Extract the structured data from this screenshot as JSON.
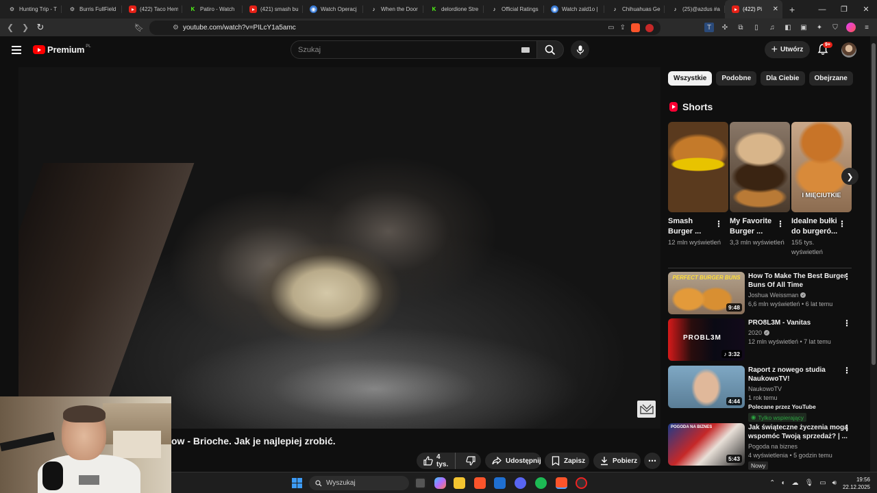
{
  "browser": {
    "tabs": [
      {
        "favicon": "gear-icon",
        "label": "Hunting Trip - T"
      },
      {
        "favicon": "gear-icon",
        "label": "Burris FullField"
      },
      {
        "favicon": "youtube-icon",
        "label": "(422) Taco Hem"
      },
      {
        "favicon": "kick-icon",
        "label": "Patiro - Watch"
      },
      {
        "favicon": "youtube-icon",
        "label": "(421) smash bu"
      },
      {
        "favicon": "eye-icon",
        "label": "Watch Operacj"
      },
      {
        "favicon": "tiktok-icon",
        "label": "When the Door"
      },
      {
        "favicon": "kick-icon",
        "label": "delordione Stre"
      },
      {
        "favicon": "tiktok-icon",
        "label": "Official Ratings"
      },
      {
        "favicon": "eye-icon",
        "label": "Watch zald1o |"
      },
      {
        "favicon": "tiktok-icon",
        "label": "Chihuahuas Ge"
      },
      {
        "favicon": "tiktok-icon",
        "label": "(25)@azdus #a"
      },
      {
        "favicon": "youtube-icon",
        "label": "(422) Pi",
        "active": true
      }
    ],
    "new_tab": "+",
    "url": "youtube.com/watch?v=PILcY1a5amc",
    "brave_badge": "1"
  },
  "youtube": {
    "logo_text": "Premium",
    "logo_region": "PL",
    "search_placeholder": "Szukaj",
    "create_label": "Utwórz",
    "notif_badge": "9+"
  },
  "video": {
    "title": "ow - Brioche. Jak je najlepiej zrobić.",
    "likes_label": "4 tys.",
    "share_label": "Udostępnij",
    "save_label": "Zapisz",
    "download_label": "Pobierz"
  },
  "sidebar": {
    "chips": [
      {
        "label": "Wszystkie",
        "active": true
      },
      {
        "label": "Podobne"
      },
      {
        "label": "Dla Ciebie"
      },
      {
        "label": "Obejrzane"
      }
    ],
    "shorts_heading": "Shorts",
    "shorts": [
      {
        "title": "Smash Burger ...",
        "views": "12 mln wyświetleń"
      },
      {
        "title": "My Favorite Burger ...",
        "views": "3,3 mln wyświetleń"
      },
      {
        "title": "Idealne bułki do burgeró...",
        "views": "155 tys. wyświetleń",
        "caption": "I MIĘCIUTKIE"
      }
    ],
    "videos": [
      {
        "title": "How To Make The Best Burger Buns Of All Time",
        "channel": "Joshua Weissman",
        "verified": true,
        "meta": "6,6 mln wyświetleń • 6 lat temu",
        "duration": "9:48",
        "thumb_text": "PERFECT BURGER BUNS"
      },
      {
        "title": "PRO8L3M - Vanitas",
        "channel": "2020",
        "verified": true,
        "meta": "12 mln wyświetleń • 7 lat temu",
        "duration": "3:32",
        "thumb_text": "PROBL3M"
      },
      {
        "title": "Raport z nowego studia NaukowoTV!",
        "channel": "NaukowoTV",
        "meta": "1 rok temu",
        "promo": "Polecane przez YouTube",
        "member": "Tylko wspierający",
        "duration": "4:44"
      },
      {
        "title": "Jak świąteczne życzenia mogą wspomóc Twoją sprzedaż? | ...",
        "channel": "Pogoda na biznes",
        "meta": "4 wyświetlenia • 5 godzin temu",
        "badge": "Nowy",
        "duration": "5:43",
        "thumb_text": "POGODA NA BIZNES"
      }
    ]
  },
  "taskbar": {
    "search_placeholder": "Wyszukaj",
    "time": "19:56",
    "date": "22.12.2025"
  }
}
